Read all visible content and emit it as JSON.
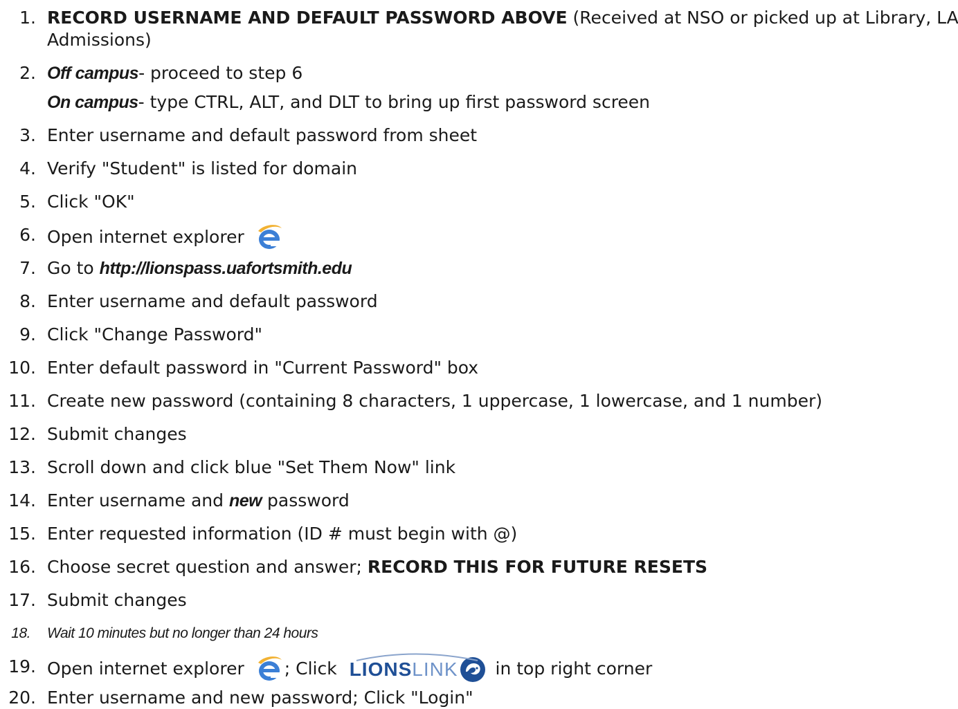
{
  "steps": [
    {
      "num": "1.",
      "bold": "RECORD USERNAME AND DEFAULT PASSWORD ABOVE",
      "text": " (Received at NSO or picked up at Library, LAC, or",
      "cont": "Admissions)"
    },
    {
      "num": "2.",
      "em": "Off campus",
      "text": "- proceed to step 6",
      "em2": "On campus",
      "text2": "- type CTRL, ALT, and DLT to bring up first password screen"
    },
    {
      "num": "3.",
      "text": "Enter username and default password from sheet"
    },
    {
      "num": "4.",
      "text": "Verify \"Student\" is listed for domain"
    },
    {
      "num": "5.",
      "text": "Click \"OK\""
    },
    {
      "num": "6.",
      "text": "Open internet explorer"
    },
    {
      "num": "7.",
      "text": "Go to ",
      "em": "http://lionspass.uafortsmith.edu"
    },
    {
      "num": "8.",
      "text": "Enter username and default password"
    },
    {
      "num": "9.",
      "text": "Click \"Change Password\""
    },
    {
      "num": "10.",
      "text": "Enter default password in \"Current Password\" box"
    },
    {
      "num": "11.",
      "text": "Create new password (containing 8 characters, 1 uppercase, 1 lowercase, and 1 number)"
    },
    {
      "num": "12.",
      "text": "Submit changes"
    },
    {
      "num": "13.",
      "text": "Scroll down and click blue \"Set Them Now\" link"
    },
    {
      "num": "14.",
      "text": "Enter username and ",
      "em": "new",
      "text2": " password"
    },
    {
      "num": "15.",
      "text": "Enter requested information (ID # must begin with @)"
    },
    {
      "num": "16.",
      "text": "Choose secret question and answer; ",
      "bold": "RECORD THIS FOR FUTURE RESETS"
    },
    {
      "num": "17.",
      "text": "Submit changes"
    },
    {
      "num": "18.",
      "text": "Wait 10 minutes but no longer than 24 hours"
    },
    {
      "num": "19.",
      "text": "Open internet explorer",
      "text2": "; Click",
      "text3": "in top right corner"
    },
    {
      "num": "20.",
      "text": "Enter username and new password; Click \"Login\""
    }
  ],
  "logo": {
    "lions": "LIONS",
    "link": "LINK"
  },
  "icons": {
    "browser": "internet-explorer-icon",
    "logo": "lionslink-logo"
  },
  "colors": {
    "text": "#1a1a1a",
    "logo_dark": "#1f4f96",
    "logo_light": "#6f93c9",
    "ie_blue": "#3b7fd6"
  }
}
